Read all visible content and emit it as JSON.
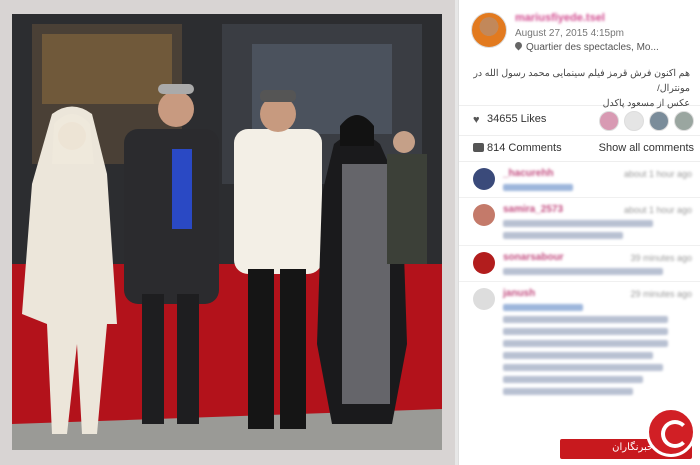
{
  "post": {
    "username": "mariusfiyede.tsel",
    "date": "August 27, 2015 4:15pm",
    "location": "Quartier des spectacles, Mo...",
    "caption_line1": "هم اکنون فرش قرمز فیلم سینمایی محمد رسول الله در مونترال/",
    "caption_line2": "عکس از مسعود پاکدل"
  },
  "stats": {
    "likes": "34655 Likes",
    "comments": "814 Comments",
    "show_all": "Show all comments"
  },
  "comments": [
    {
      "user": "_hacurehh",
      "time": "about 1 hour ago"
    },
    {
      "user": "samira_2573",
      "time": "about 1 hour ago"
    },
    {
      "user": "sonarsabour",
      "time": "39 minutes ago"
    },
    {
      "user": "janush",
      "time": "29 minutes ago"
    }
  ],
  "watermark": {
    "text": "باشگاه خبرنگاران"
  },
  "colors": {
    "carpet": "#b3121b",
    "accent": "#d14b8f",
    "brand_red": "#c8191e"
  }
}
